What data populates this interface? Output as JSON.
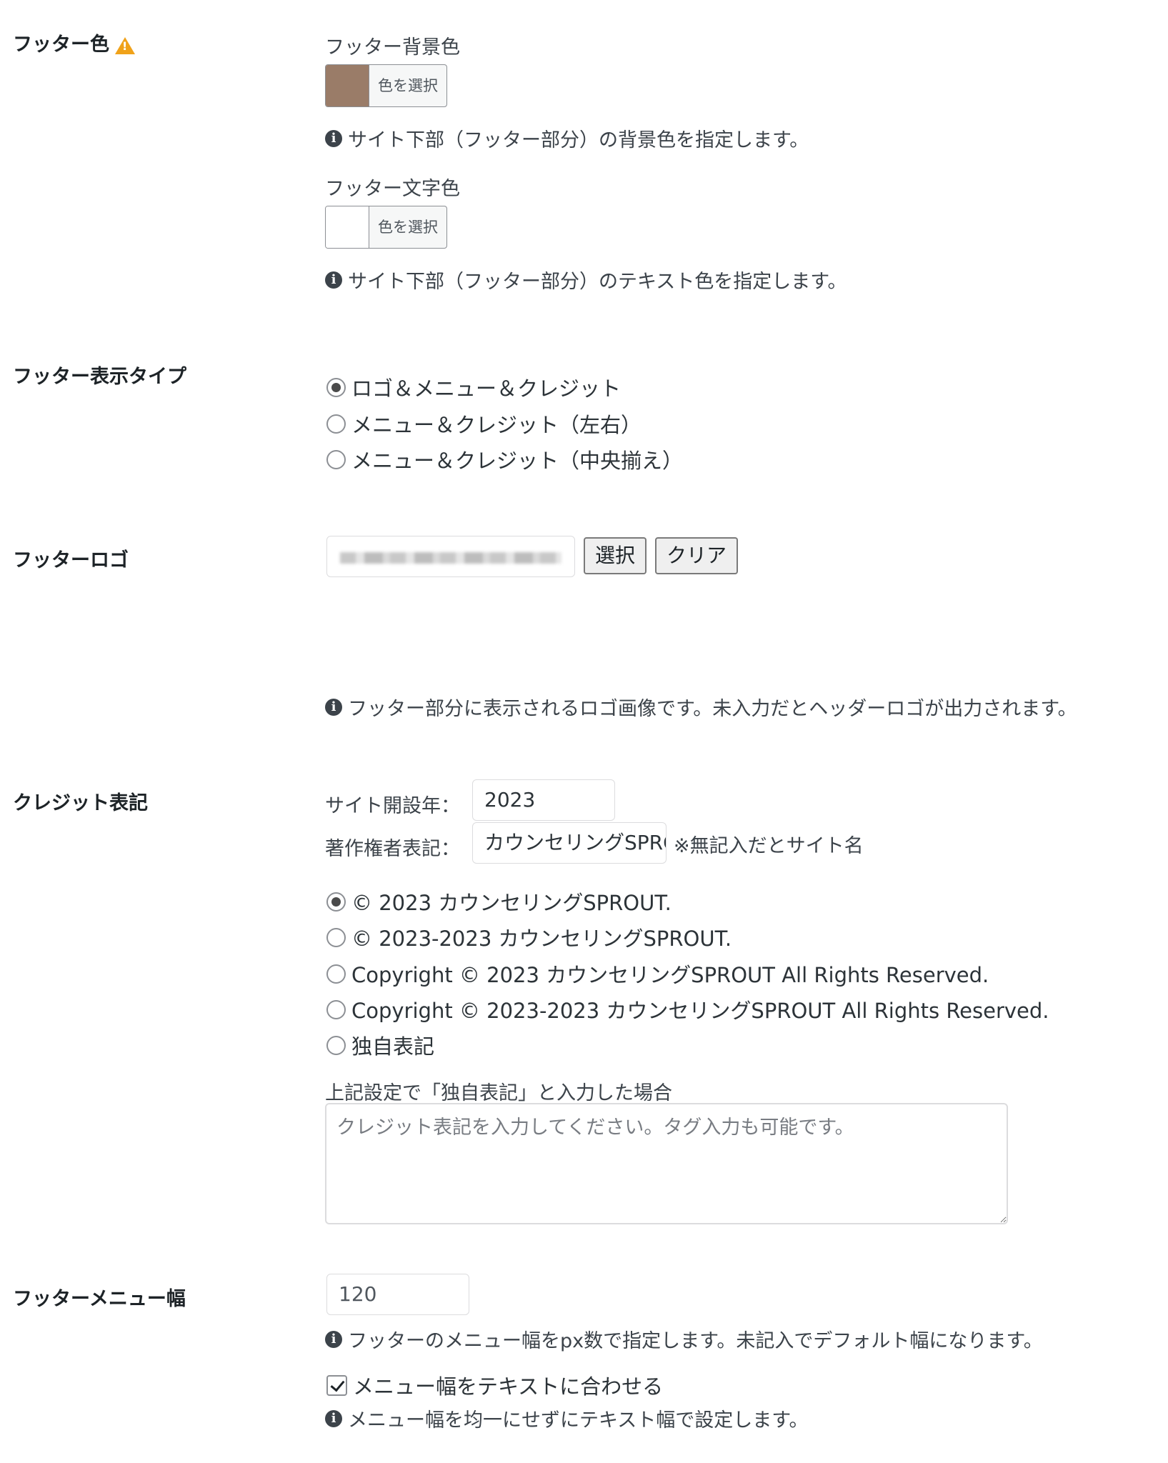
{
  "footer_color": {
    "label": "フッター色",
    "bg": {
      "label": "フッター背景色",
      "button": "色を選択",
      "swatch": "#9a7c68",
      "note": "サイト下部（フッター部分）の背景色を指定します。"
    },
    "text": {
      "label": "フッター文字色",
      "button": "色を選択",
      "swatch": "#ffffff",
      "note": "サイト下部（フッター部分）のテキスト色を指定します。"
    }
  },
  "display_type": {
    "label": "フッター表示タイプ",
    "options": [
      "ロゴ＆メニュー＆クレジット",
      "メニュー＆クレジット（左右）",
      "メニュー＆クレジット（中央揃え）"
    ],
    "selected": 0
  },
  "logo": {
    "label": "フッターロゴ",
    "select_button": "選択",
    "clear_button": "クリア",
    "note": "フッター部分に表示されるロゴ画像です。未入力だとヘッダーロゴが出力されます。"
  },
  "credit": {
    "label": "クレジット表記",
    "year_label": "サイト開設年：",
    "year_value": "2023",
    "owner_label": "著作権者表記：",
    "owner_value": "カウンセリングSPROUT",
    "owner_hint": "※無記入だとサイト名",
    "options": [
      "© 2023 カウンセリングSPROUT.",
      "© 2023-2023 カウンセリングSPROUT.",
      "Copyright © 2023 カウンセリングSPROUT All Rights Reserved.",
      "Copyright © 2023-2023 カウンセリングSPROUT All Rights Reserved.",
      "独自表記"
    ],
    "selected": 0,
    "custom_label": "上記設定で「独自表記」と入力した場合",
    "custom_placeholder": "クレジット表記を入力してください。タグ入力も可能です。"
  },
  "menu_width": {
    "label": "フッターメニュー幅",
    "value": "120",
    "note": "フッターのメニュー幅をpx数で指定します。未記入でデフォルト幅になります。",
    "fit_label": "メニュー幅をテキストに合わせる",
    "fit_checked": true,
    "fit_note": "メニュー幅を均一にせずにテキスト幅で設定します。"
  },
  "colors": {
    "warning": "#f0a21a",
    "swatch_bg": "#9a7c68"
  },
  "icons": {
    "warning": "warning-icon",
    "info": "info-icon",
    "checkmark": "checkmark-icon"
  }
}
